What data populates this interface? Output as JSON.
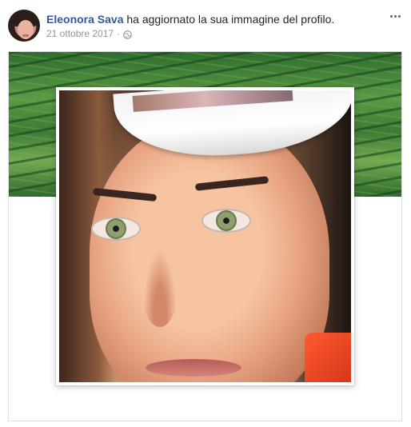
{
  "post": {
    "author": "Eleonora Sava",
    "action": " ha aggiornato la sua immagine del profilo.",
    "date": "21 ottobre 2017",
    "separator": "·",
    "icons": {
      "avatar": "avatar",
      "privacy": "globe-icon",
      "more": "more-options-icon"
    }
  }
}
